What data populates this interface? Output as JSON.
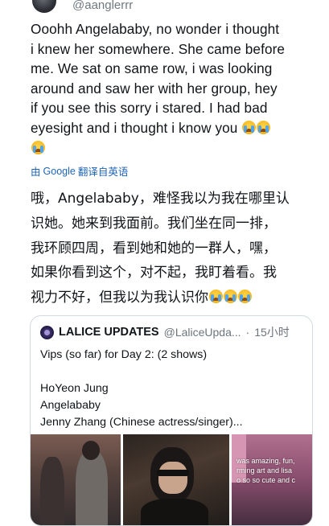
{
  "header": {
    "handle": "@aanglerrr"
  },
  "tweet": {
    "text_lines": [
      "Ooohh Angelababy, no wonder i thought",
      "i knew her somewhere. She came before",
      "me. We sat on same row, i was looking",
      "around and saw her with her group, hey",
      "if you see this sorry i stared. I had bad",
      "eyesight and i thought i know you"
    ],
    "emoji": "loudly-crying-face"
  },
  "translate": {
    "by": "由",
    "brand": "Google",
    "action": "翻译自英语"
  },
  "translation": {
    "lines": [
      "哦，Angelababy，难怪我以为我在哪里认",
      "识她。她来到我面前。我们坐在同一排，",
      "我环顾四周，看到她和她的一群人，嘿，",
      "如果你看到这个，对不起，我盯着看。我",
      "视力不好，但我以为我认识你"
    ]
  },
  "quote": {
    "name": "LALICE UPDATES",
    "handle": "@LaliceUpda...",
    "separator": "·",
    "time": "15小时",
    "lines": [
      "Vips (so far) for Day 2: (2 shows)",
      "",
      "HoYeon Jung",
      "Angelababy",
      "Jenny Zhang (Chinese actress/singer)..."
    ],
    "media_caption_lines": [
      "was amazing, fun,",
      "rming art and lisa",
      "o so so cute and c"
    ]
  },
  "colors": {
    "link_blue": "#1d64b8",
    "muted": "#6c757d",
    "border": "#cfd9de"
  }
}
